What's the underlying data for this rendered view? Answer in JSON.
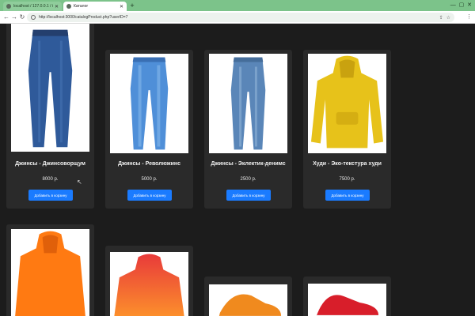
{
  "browser": {
    "tabs": [
      {
        "title": "localhost / 127.0.0.1 / internetshop",
        "active": false
      },
      {
        "title": "Каталог",
        "active": true
      }
    ],
    "url": "http://localhost:3000/catalogProduct.php?userID=7"
  },
  "products": [
    {
      "name": "Джинсы - Джинсоворщум",
      "price": "8000 р.",
      "button": "Добавить в корзину",
      "image": "jeans-dark"
    },
    {
      "name": "Джинсы - Революжинс",
      "price": "5000 р.",
      "button": "Добавить в корзину",
      "image": "jeans-light"
    },
    {
      "name": "Джинсы - Эклектик-денимс",
      "price": "2500 р.",
      "button": "Добавить в корзину",
      "image": "jeans-medium"
    },
    {
      "name": "Худи - Эко-текстура худи",
      "price": "7500 р.",
      "button": "Добавить в корзину",
      "image": "hoodie-yellow"
    },
    {
      "image": "hoodie-orange"
    },
    {
      "image": "hoodie-gradient"
    },
    {
      "image": "sneaker-orange"
    },
    {
      "image": "sneaker-red"
    }
  ],
  "colors": {
    "button": "#1a7bff",
    "card": "#2a2a2a",
    "page": "#1c1c1c",
    "tabstrip": "#7cc38a"
  }
}
